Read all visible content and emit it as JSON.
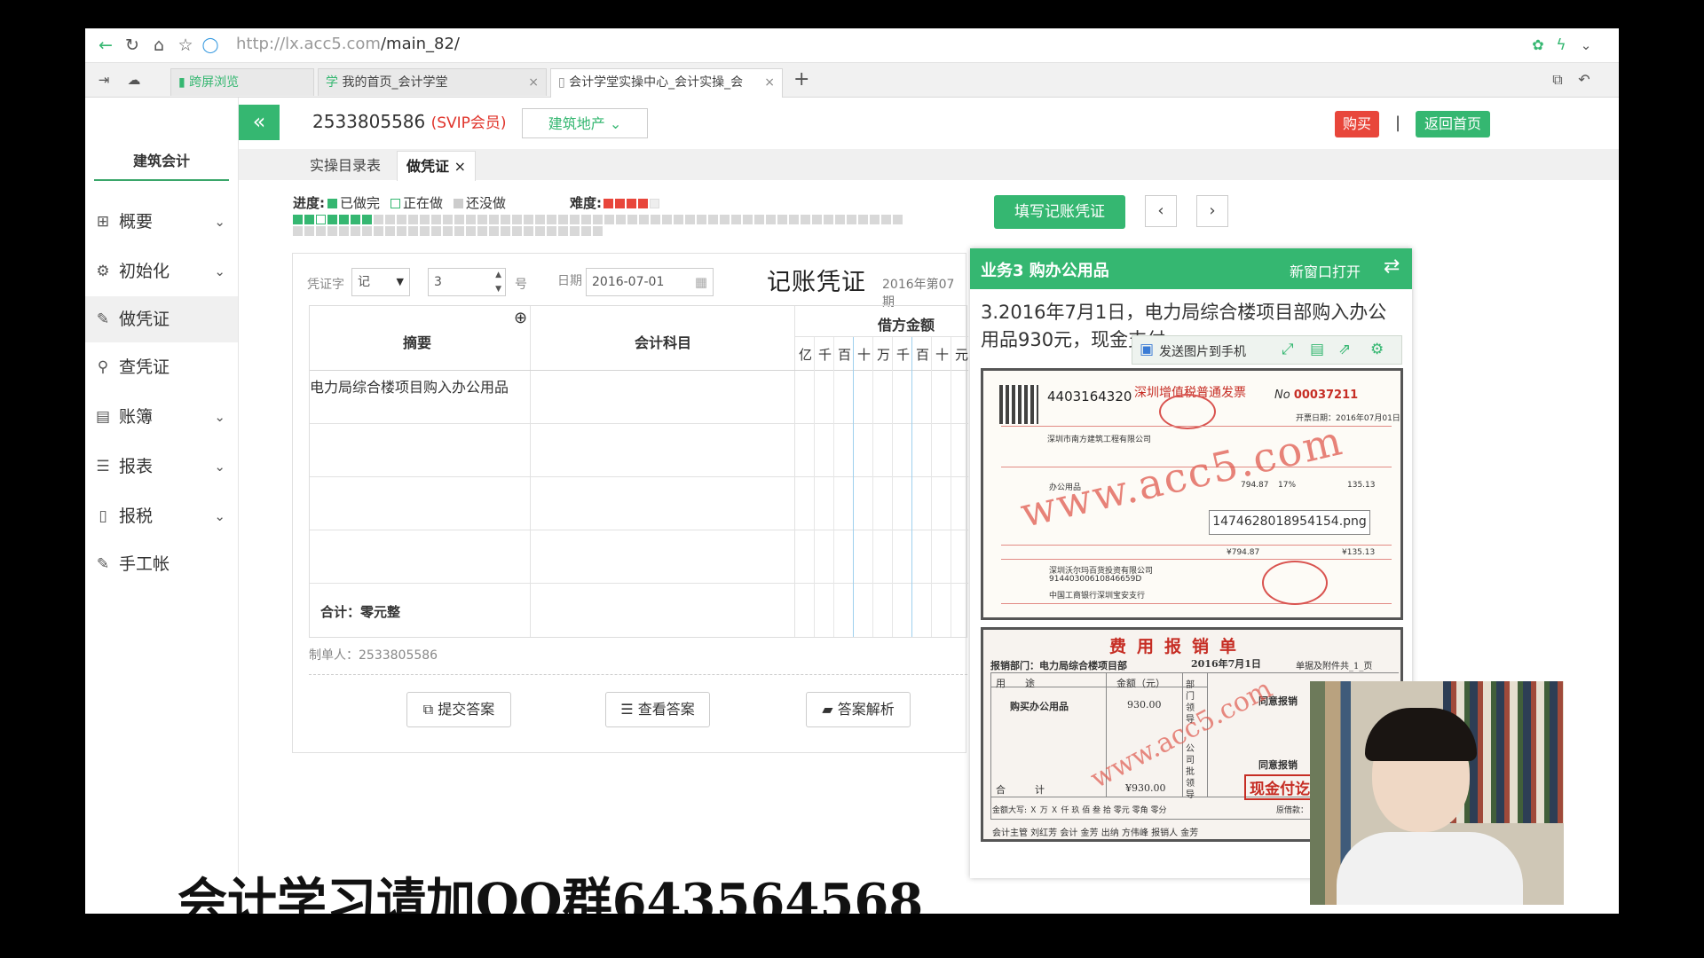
{
  "browser": {
    "url_host": "http://lx.acc5.com",
    "url_path": "/main_82/",
    "tabs": [
      {
        "label": "跨屏浏览"
      },
      {
        "label": "我的首页_会计学堂"
      },
      {
        "label": "会计学堂实操中心_会计实操_会"
      }
    ],
    "new_tab": "+"
  },
  "sidebar": {
    "title": "建筑会计",
    "items": [
      {
        "label": "概要",
        "icon": "grid-icon",
        "has_chevron": true
      },
      {
        "label": "初始化",
        "icon": "gear-icon",
        "has_chevron": true
      },
      {
        "label": "做凭证",
        "icon": "pen-icon",
        "has_chevron": false,
        "active": true
      },
      {
        "label": "查凭证",
        "icon": "search-icon",
        "has_chevron": false
      },
      {
        "label": "账簿",
        "icon": "book-icon",
        "has_chevron": true
      },
      {
        "label": "报表",
        "icon": "report-icon",
        "has_chevron": true
      },
      {
        "label": "报税",
        "icon": "file-icon",
        "has_chevron": true
      },
      {
        "label": "手工帐",
        "icon": "pen-icon",
        "has_chevron": false
      }
    ]
  },
  "header": {
    "collapse": "«",
    "user_id": "2533805586",
    "membership": "(SVIP会员)",
    "category": "建筑地产",
    "buy": "购买",
    "separator": "|",
    "home": "返回首页"
  },
  "subtabs": [
    {
      "label": "实操目录表"
    },
    {
      "label": "做凭证"
    }
  ],
  "progress": {
    "label": "进度:",
    "done": "已做完",
    "doing": "正在做",
    "todo": "还没做",
    "difficulty_label": "难度:",
    "difficulty_stars": 4,
    "completed_count": 7,
    "current_index": 3,
    "total_cells": 80
  },
  "actions": {
    "fill_voucher": "填写记账凭证",
    "prev": "‹",
    "next": "›"
  },
  "voucher": {
    "word_label": "凭证字",
    "word_value": "记",
    "number_value": "3",
    "number_suffix": "号",
    "date_label": "日期",
    "date_value": "2016-07-01",
    "title": "记账凭证",
    "period": "2016年第07期",
    "col_summary": "摘要",
    "col_account": "会计科目",
    "col_debit": "借方金额",
    "digits": [
      "亿",
      "千",
      "百",
      "十",
      "万",
      "千",
      "百",
      "十",
      "元"
    ],
    "rows": [
      {
        "summary": "电力局综合楼项目购入办公用品",
        "account": ""
      },
      {
        "summary": "",
        "account": ""
      },
      {
        "summary": "",
        "account": ""
      },
      {
        "summary": "",
        "account": ""
      }
    ],
    "total": "合计：零元整",
    "maker": "制单人：2533805586",
    "submit": "提交答案",
    "view_answer": "查看答案",
    "analysis": "答案解析"
  },
  "business": {
    "title": "业务3 购办公用品",
    "new_window": "新窗口打开",
    "description": "3.2016年7月1日，电力局综合楼项目部购入办公用品930元，现金支付",
    "send_to_phone": "发送图片到手机",
    "tooltip": "1474628018954154.png"
  },
  "invoice": {
    "code": "4403164320",
    "title": "深圳增值税普通发票",
    "no_label": "No",
    "no_value": "00037211",
    "date": "开票日期：2016年07月01日",
    "buyer": "深圳市南方建筑工程有限公司",
    "item": "办公用品",
    "amount": "794.87",
    "rate": "17%",
    "tax": "135.13",
    "total_amount": "¥794.87",
    "total_tax": "¥135.13",
    "seller": "深圳沃尔玛百货投资有限公司",
    "seller_tax_id": "91440300610846659D",
    "bank": "中国工商银行深圳宝安支行",
    "watermark": "www.acc5.com"
  },
  "expense": {
    "title": "费用报销单",
    "dept": "报销部门：电力局综合楼项目部",
    "date": "2016年7月1日",
    "attachments": "单据及附件共_1_页",
    "col_use": "用　　途",
    "col_amount": "金额（元）",
    "row1_use": "购买办公用品",
    "row1_amount": "930.00",
    "total_label": "合　　　计",
    "total_value": "¥930.00",
    "cap_label": "金额大写: Ｘ 万 Ｘ 仟 玖 佰 叁 拾 零元 零角 零分",
    "pre_borrow": "原借款：",
    "dept_leader": "部门领导",
    "company_leader": "公司批领导",
    "approve": "同意报销",
    "stamp": "现金付讫",
    "sign": "会计主管  刘红芳   会计  金芳    出纳  方伟峰   报销人  金芳",
    "watermark": "www.acc5.com"
  },
  "overlay": {
    "banner": "会计学习请加QQ群643564568"
  },
  "colors": {
    "accent": "#35b771",
    "danger": "#e8463b",
    "invoice_red": "#c62d24"
  }
}
